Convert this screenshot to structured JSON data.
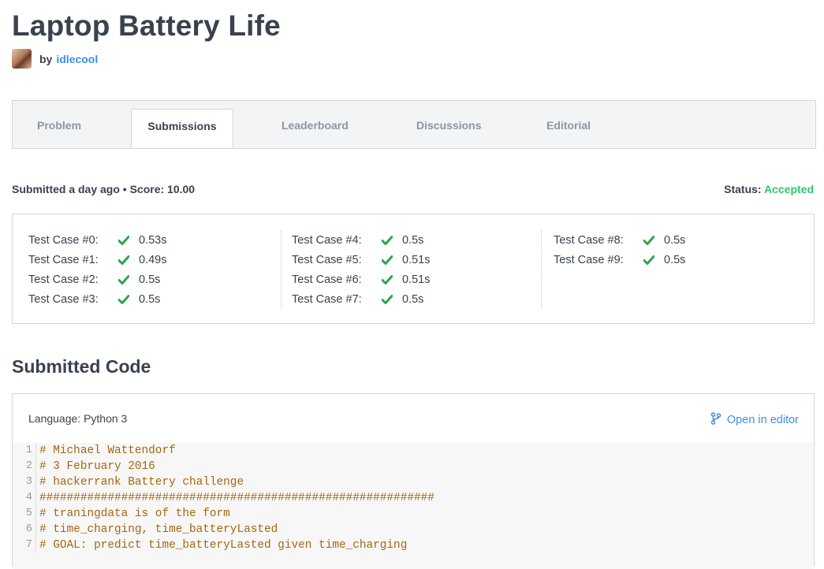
{
  "page": {
    "title": "Laptop Battery Life",
    "by_label": "by",
    "author": "idlecool"
  },
  "tabs": [
    {
      "label": "Problem",
      "active": false
    },
    {
      "label": "Submissions",
      "active": true
    },
    {
      "label": "Leaderboard",
      "active": false
    },
    {
      "label": "Discussions",
      "active": false
    },
    {
      "label": "Editorial",
      "active": false
    }
  ],
  "submission": {
    "meta": "Submitted a day ago • Score: 10.00",
    "status_label": "Status:",
    "status_value": "Accepted",
    "status_color": "#2ec866"
  },
  "test_cases": [
    [
      {
        "label": "Test Case #0:",
        "time": "0.53s"
      },
      {
        "label": "Test Case #1:",
        "time": "0.49s"
      },
      {
        "label": "Test Case #2:",
        "time": "0.5s"
      },
      {
        "label": "Test Case #3:",
        "time": "0.5s"
      }
    ],
    [
      {
        "label": "Test Case #4:",
        "time": "0.5s"
      },
      {
        "label": "Test Case #5:",
        "time": "0.51s"
      },
      {
        "label": "Test Case #6:",
        "time": "0.51s"
      },
      {
        "label": "Test Case #7:",
        "time": "0.5s"
      }
    ],
    [
      {
        "label": "Test Case #8:",
        "time": "0.5s"
      },
      {
        "label": "Test Case #9:",
        "time": "0.5s"
      }
    ]
  ],
  "check_icon": "check-icon",
  "check_color": "#2ea44f",
  "code_section": {
    "heading": "Submitted Code",
    "language": "Language: Python 3",
    "open_editor": "Open in editor",
    "open_editor_icon": "branch-icon",
    "lines": [
      {
        "n": "1",
        "text": "# Michael Wattendorf"
      },
      {
        "n": "2",
        "text": "# 3 February 2016"
      },
      {
        "n": "3",
        "text": "# hackerrank Battery challenge"
      },
      {
        "n": "4",
        "text": "##########################################################"
      },
      {
        "n": "5",
        "text": "# traningdata is of the form"
      },
      {
        "n": "6",
        "text": "# time_charging, time_batteryLasted"
      },
      {
        "n": "7",
        "text": "# GOAL: predict time_batteryLasted given time_charging"
      }
    ]
  },
  "colors": {
    "accent": "#3d8fe0",
    "success": "#2ec866",
    "comment": "#a8650e"
  }
}
